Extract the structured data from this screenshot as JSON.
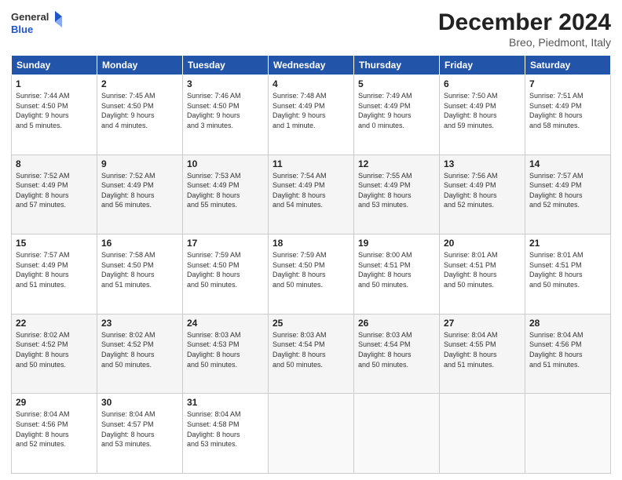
{
  "header": {
    "logo_general": "General",
    "logo_blue": "Blue",
    "month_title": "December 2024",
    "location": "Breo, Piedmont, Italy"
  },
  "weekdays": [
    "Sunday",
    "Monday",
    "Tuesday",
    "Wednesday",
    "Thursday",
    "Friday",
    "Saturday"
  ],
  "weeks": [
    [
      {
        "day": "1",
        "info": "Sunrise: 7:44 AM\nSunset: 4:50 PM\nDaylight: 9 hours\nand 5 minutes."
      },
      {
        "day": "2",
        "info": "Sunrise: 7:45 AM\nSunset: 4:50 PM\nDaylight: 9 hours\nand 4 minutes."
      },
      {
        "day": "3",
        "info": "Sunrise: 7:46 AM\nSunset: 4:50 PM\nDaylight: 9 hours\nand 3 minutes."
      },
      {
        "day": "4",
        "info": "Sunrise: 7:48 AM\nSunset: 4:49 PM\nDaylight: 9 hours\nand 1 minute."
      },
      {
        "day": "5",
        "info": "Sunrise: 7:49 AM\nSunset: 4:49 PM\nDaylight: 9 hours\nand 0 minutes."
      },
      {
        "day": "6",
        "info": "Sunrise: 7:50 AM\nSunset: 4:49 PM\nDaylight: 8 hours\nand 59 minutes."
      },
      {
        "day": "7",
        "info": "Sunrise: 7:51 AM\nSunset: 4:49 PM\nDaylight: 8 hours\nand 58 minutes."
      }
    ],
    [
      {
        "day": "8",
        "info": "Sunrise: 7:52 AM\nSunset: 4:49 PM\nDaylight: 8 hours\nand 57 minutes."
      },
      {
        "day": "9",
        "info": "Sunrise: 7:52 AM\nSunset: 4:49 PM\nDaylight: 8 hours\nand 56 minutes."
      },
      {
        "day": "10",
        "info": "Sunrise: 7:53 AM\nSunset: 4:49 PM\nDaylight: 8 hours\nand 55 minutes."
      },
      {
        "day": "11",
        "info": "Sunrise: 7:54 AM\nSunset: 4:49 PM\nDaylight: 8 hours\nand 54 minutes."
      },
      {
        "day": "12",
        "info": "Sunrise: 7:55 AM\nSunset: 4:49 PM\nDaylight: 8 hours\nand 53 minutes."
      },
      {
        "day": "13",
        "info": "Sunrise: 7:56 AM\nSunset: 4:49 PM\nDaylight: 8 hours\nand 52 minutes."
      },
      {
        "day": "14",
        "info": "Sunrise: 7:57 AM\nSunset: 4:49 PM\nDaylight: 8 hours\nand 52 minutes."
      }
    ],
    [
      {
        "day": "15",
        "info": "Sunrise: 7:57 AM\nSunset: 4:49 PM\nDaylight: 8 hours\nand 51 minutes."
      },
      {
        "day": "16",
        "info": "Sunrise: 7:58 AM\nSunset: 4:50 PM\nDaylight: 8 hours\nand 51 minutes."
      },
      {
        "day": "17",
        "info": "Sunrise: 7:59 AM\nSunset: 4:50 PM\nDaylight: 8 hours\nand 50 minutes."
      },
      {
        "day": "18",
        "info": "Sunrise: 7:59 AM\nSunset: 4:50 PM\nDaylight: 8 hours\nand 50 minutes."
      },
      {
        "day": "19",
        "info": "Sunrise: 8:00 AM\nSunset: 4:51 PM\nDaylight: 8 hours\nand 50 minutes."
      },
      {
        "day": "20",
        "info": "Sunrise: 8:01 AM\nSunset: 4:51 PM\nDaylight: 8 hours\nand 50 minutes."
      },
      {
        "day": "21",
        "info": "Sunrise: 8:01 AM\nSunset: 4:51 PM\nDaylight: 8 hours\nand 50 minutes."
      }
    ],
    [
      {
        "day": "22",
        "info": "Sunrise: 8:02 AM\nSunset: 4:52 PM\nDaylight: 8 hours\nand 50 minutes."
      },
      {
        "day": "23",
        "info": "Sunrise: 8:02 AM\nSunset: 4:52 PM\nDaylight: 8 hours\nand 50 minutes."
      },
      {
        "day": "24",
        "info": "Sunrise: 8:03 AM\nSunset: 4:53 PM\nDaylight: 8 hours\nand 50 minutes."
      },
      {
        "day": "25",
        "info": "Sunrise: 8:03 AM\nSunset: 4:54 PM\nDaylight: 8 hours\nand 50 minutes."
      },
      {
        "day": "26",
        "info": "Sunrise: 8:03 AM\nSunset: 4:54 PM\nDaylight: 8 hours\nand 50 minutes."
      },
      {
        "day": "27",
        "info": "Sunrise: 8:04 AM\nSunset: 4:55 PM\nDaylight: 8 hours\nand 51 minutes."
      },
      {
        "day": "28",
        "info": "Sunrise: 8:04 AM\nSunset: 4:56 PM\nDaylight: 8 hours\nand 51 minutes."
      }
    ],
    [
      {
        "day": "29",
        "info": "Sunrise: 8:04 AM\nSunset: 4:56 PM\nDaylight: 8 hours\nand 52 minutes."
      },
      {
        "day": "30",
        "info": "Sunrise: 8:04 AM\nSunset: 4:57 PM\nDaylight: 8 hours\nand 53 minutes."
      },
      {
        "day": "31",
        "info": "Sunrise: 8:04 AM\nSunset: 4:58 PM\nDaylight: 8 hours\nand 53 minutes."
      },
      {
        "day": "",
        "info": ""
      },
      {
        "day": "",
        "info": ""
      },
      {
        "day": "",
        "info": ""
      },
      {
        "day": "",
        "info": ""
      }
    ]
  ]
}
